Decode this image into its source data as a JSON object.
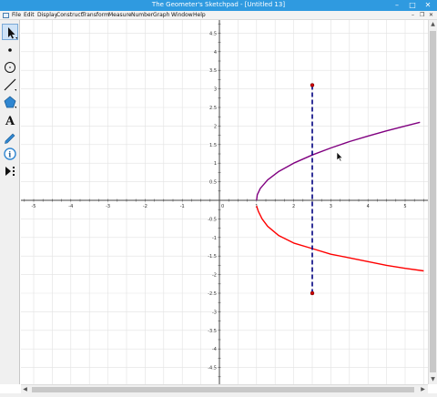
{
  "window": {
    "title": "The Geometer's Sketchpad - [Untitled 13]"
  },
  "window_controls": {
    "minimize": "–",
    "maximize": "□",
    "close": "✕"
  },
  "menu": {
    "items": [
      "File",
      "Edit",
      "Display",
      "Construct",
      "Transform",
      "Measure",
      "Number",
      "Graph",
      "Window",
      "Help"
    ]
  },
  "mdi_controls": {
    "minimize": "–",
    "restore": "❐",
    "close": "✕"
  },
  "toolbox": {
    "tools": [
      {
        "name": "arrow-select-tool",
        "icon": "arrow-icon",
        "selected": true
      },
      {
        "name": "point-tool",
        "icon": "point-icon"
      },
      {
        "name": "compass-tool",
        "icon": "circle-icon"
      },
      {
        "name": "straightedge-tool",
        "icon": "segment-icon"
      },
      {
        "name": "polygon-tool",
        "icon": "polygon-icon"
      },
      {
        "name": "text-tool",
        "icon": "text-A-icon"
      },
      {
        "name": "marker-tool",
        "icon": "pencil-icon"
      },
      {
        "name": "information-tool",
        "icon": "info-icon"
      },
      {
        "name": "custom-tool",
        "icon": "custom-tool-icon"
      }
    ]
  },
  "colors": {
    "accent": "#2f9ae0",
    "upper_branch": "#800080",
    "lower_branch": "#ff0000",
    "dashed_segment": "#000080",
    "point": "#cc0000",
    "grid": "#e2e2e2",
    "axis": "#444444"
  },
  "graph": {
    "x_ticks": [
      -5,
      -4,
      -3,
      -2,
      -1,
      1,
      2,
      3,
      4,
      5
    ],
    "y_ticks": [
      4.5,
      4,
      3.5,
      3,
      2.5,
      2,
      1.5,
      1,
      0.5,
      -0.5,
      -1,
      -1.5,
      -2,
      -2.5,
      -3,
      -3.5,
      -4,
      -4.5
    ],
    "origin_label": "0",
    "dashed_segment": {
      "x": 2.5,
      "y_top": 3.1,
      "y_bottom": -2.5
    }
  },
  "chart_data": {
    "type": "line",
    "x_ticks": [
      -5,
      -4,
      -3,
      -2,
      -1,
      0,
      1,
      2,
      3,
      4,
      5
    ],
    "y_ticks": [
      -4.5,
      -4,
      -3.5,
      -3,
      -2.5,
      -2,
      -1.5,
      -1,
      -0.5,
      0,
      0.5,
      1,
      1.5,
      2,
      2.5,
      3,
      3.5,
      4,
      4.5
    ],
    "series": [
      {
        "values": [
          [
            1.0,
            0
          ],
          [
            1.02,
            0.15
          ],
          [
            1.1,
            0.32
          ],
          [
            1.3,
            0.55
          ],
          [
            1.6,
            0.78
          ],
          [
            2.0,
            1.0
          ],
          [
            2.5,
            1.22
          ],
          [
            3.0,
            1.41
          ],
          [
            3.5,
            1.58
          ],
          [
            4.0,
            1.73
          ],
          [
            4.5,
            1.87
          ],
          [
            5.0,
            2.0
          ],
          [
            5.4,
            2.1
          ]
        ]
      },
      {
        "values": [
          [
            1.0,
            -0.15
          ],
          [
            1.05,
            -0.3
          ],
          [
            1.15,
            -0.5
          ],
          [
            1.3,
            -0.7
          ],
          [
            1.6,
            -0.95
          ],
          [
            2.0,
            -1.15
          ],
          [
            2.5,
            -1.3
          ],
          [
            3.0,
            -1.45
          ],
          [
            3.5,
            -1.55
          ],
          [
            4.0,
            -1.65
          ],
          [
            4.5,
            -1.75
          ],
          [
            5.0,
            -1.83
          ],
          [
            5.5,
            -1.9
          ]
        ]
      }
    ],
    "vertical_segment": {
      "x": 2.5,
      "y": [
        -2.5,
        3.1
      ]
    },
    "xlim": [
      -5.5,
      5.5
    ],
    "ylim": [
      -4.7,
      4.8
    ],
    "grid": true
  }
}
